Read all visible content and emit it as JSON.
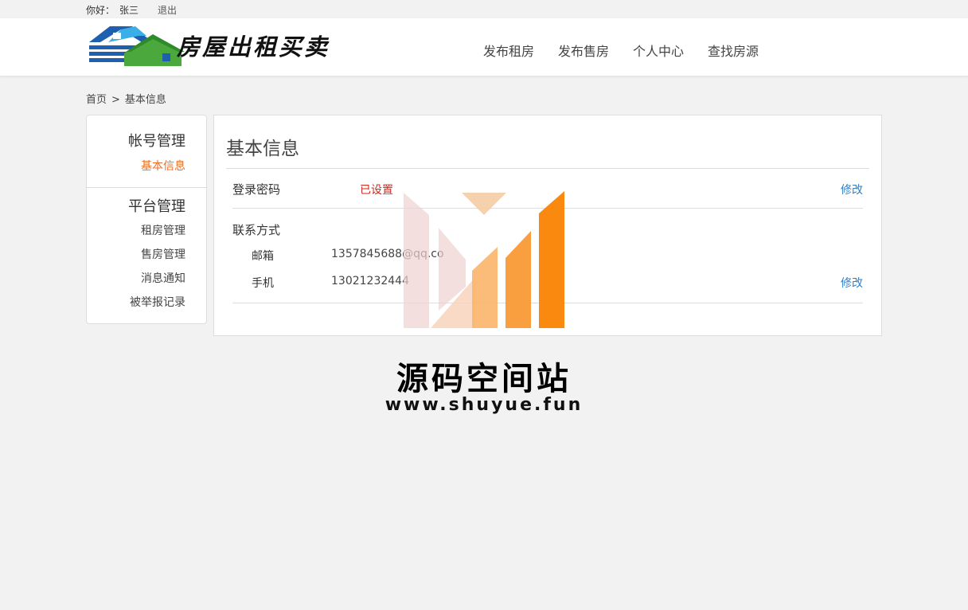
{
  "topbar": {
    "greeting": "你好：",
    "username": "张三",
    "logout": "退出"
  },
  "header": {
    "brand": "房屋出租买卖",
    "nav": [
      {
        "label": "发布租房"
      },
      {
        "label": "发布售房"
      },
      {
        "label": "个人中心"
      },
      {
        "label": "查找房源"
      }
    ]
  },
  "breadcrumb": {
    "home": "首页",
    "separator": ">",
    "current": "基本信息"
  },
  "sidebar": {
    "account_title": "帐号管理",
    "account_items": [
      {
        "label": "基本信息",
        "active": true
      }
    ],
    "platform_title": "平台管理",
    "platform_items": [
      {
        "label": "租房管理"
      },
      {
        "label": "售房管理"
      },
      {
        "label": "消息通知"
      },
      {
        "label": "被举报记录"
      }
    ]
  },
  "main": {
    "title": "基本信息",
    "password": {
      "label": "登录密码",
      "status": "已设置",
      "action": "修改"
    },
    "contact": {
      "title": "联系方式",
      "email_label": "邮箱",
      "email_value": "1357845688@qq.co",
      "phone_label": "手机",
      "phone_value": "13021232444",
      "action": "修改"
    }
  },
  "watermark": {
    "title": "源码空间站",
    "url": "www.shuyue.fun"
  },
  "colors": {
    "accent_orange": "#e8702a",
    "link_blue": "#2e7fc8",
    "status_red": "#d0281d"
  }
}
